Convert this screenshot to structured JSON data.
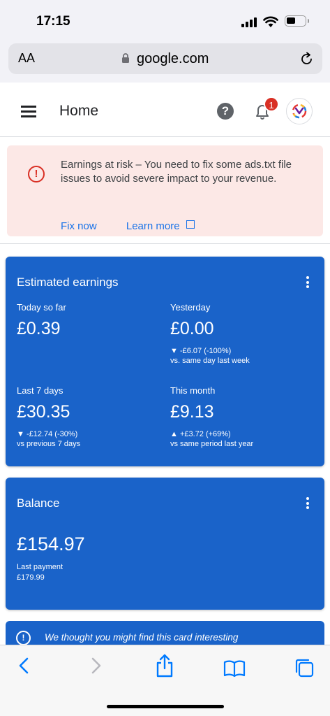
{
  "status_bar": {
    "time": "17:15"
  },
  "url_bar": {
    "text_size_label": "AA",
    "domain": "google.com"
  },
  "header": {
    "title": "Home",
    "help_glyph": "?",
    "notification_count": "1"
  },
  "alert": {
    "icon_glyph": "!",
    "message": "Earnings at risk – You need to fix some ads.txt file issues to avoid severe impact to your revenue.",
    "fix_label": "Fix now",
    "learn_label": "Learn more"
  },
  "earnings": {
    "title": "Estimated earnings",
    "today": {
      "label": "Today so far",
      "value": "£0.39"
    },
    "yesterday": {
      "label": "Yesterday",
      "value": "£0.00",
      "delta": "▼ -£6.07 (-100%)",
      "comparison": "vs. same day last week"
    },
    "last7": {
      "label": "Last 7 days",
      "value": "£30.35",
      "delta": "▼ -£12.74 (-30%)",
      "comparison": "vs previous 7 days"
    },
    "month": {
      "label": "This month",
      "value": "£9.13",
      "delta": "▲ +£3.72 (+69%)",
      "comparison": "vs same period last year"
    }
  },
  "balance": {
    "title": "Balance",
    "value": "£154.97",
    "last_payment_label": "Last payment",
    "last_payment_value": "£179.99"
  },
  "suggestion_card": {
    "icon_glyph": "!",
    "text": "We thought you might find this card interesting"
  },
  "colors": {
    "card_blue": "#1a63c9",
    "alert_bg": "#fce8e6",
    "alert_red": "#d93025",
    "link_blue": "#1a73e8",
    "ios_blue": "#007aff"
  },
  "icons": [
    "signal-icon",
    "wifi-icon",
    "battery-icon",
    "lock-icon",
    "reload-icon",
    "menu-icon",
    "help-icon",
    "bell-icon",
    "avatar",
    "alert-icon",
    "external-link-icon",
    "more-vert-icon",
    "lightbulb-icon",
    "back-icon",
    "forward-icon",
    "share-icon",
    "bookmarks-icon",
    "tabs-icon"
  ]
}
